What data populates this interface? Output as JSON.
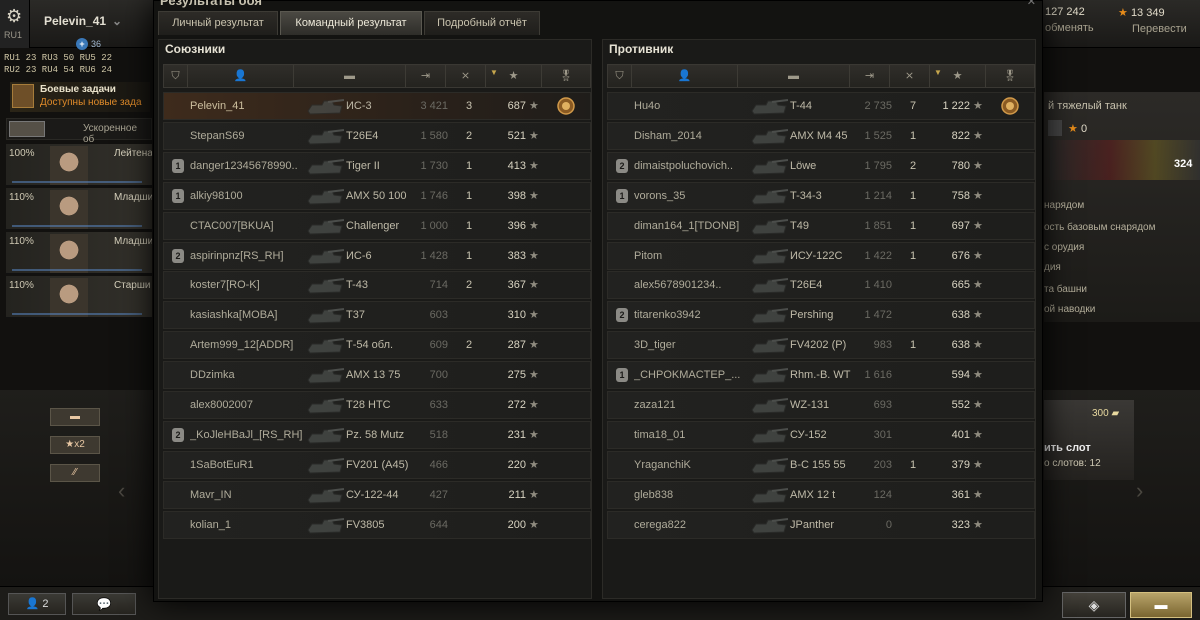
{
  "topbar": {
    "player_name": "Pelevin_41",
    "server": "RU1",
    "gold": "127 242",
    "gold_action": "обменять",
    "free_xp": "13 349",
    "free_xp_action": "Перевести",
    "online_count": "36",
    "server_lines": [
      "RU1 23 RU3 50 RU5 22",
      "RU2 23 RU4 54 RU6 24"
    ]
  },
  "left_panel": {
    "missions_title": "Боевые задачи",
    "missions_sub": "Доступны новые зада",
    "speedup": "Ускоренное об",
    "crew": [
      {
        "pct": "100%",
        "rank": "Лейтена"
      },
      {
        "pct": "110%",
        "rank": "Младши"
      },
      {
        "pct": "110%",
        "rank": "Младши"
      },
      {
        "pct": "110%",
        "rank": "Старши"
      }
    ],
    "x2_label": "★x2"
  },
  "right_panel": {
    "tank_type": "й тяжелый танк",
    "zero": "0",
    "value": "324",
    "mods": [
      "нарядом",
      "ость базовым снарядом",
      "с орудия",
      "дия",
      "та башни",
      "ой наводки"
    ],
    "slot_gold": "300",
    "slot_title": "ить слот",
    "slot_sub": "о слотов: 12"
  },
  "bottombar": {
    "players": "2"
  },
  "modal": {
    "title": "Результаты боя",
    "tabs": [
      "Личный результат",
      "Командный результат",
      "Подробный отчёт"
    ],
    "active_tab": 1,
    "allies_title": "Союзники",
    "enemies_title": "Противник"
  },
  "allies": [
    {
      "name": "Pelevin_41",
      "tank": "ИС-3",
      "damage": "3 421",
      "kills": "3",
      "xp": "687",
      "squad": "",
      "medal": true,
      "self": true
    },
    {
      "name": "StepanS69",
      "tank": "T26E4",
      "damage": "1 580",
      "kills": "2",
      "xp": "521",
      "squad": "",
      "medal": false
    },
    {
      "name": "danger12345678990..",
      "tank": "Tiger II",
      "damage": "1 730",
      "kills": "1",
      "xp": "413",
      "squad": "1",
      "medal": false
    },
    {
      "name": "alkiy98100",
      "tank": "AMX 50 100",
      "damage": "1 746",
      "kills": "1",
      "xp": "398",
      "squad": "1",
      "medal": false
    },
    {
      "name": "CTAC007[BKUA]",
      "tank": "Challenger",
      "damage": "1 000",
      "kills": "1",
      "xp": "396",
      "squad": "",
      "medal": false
    },
    {
      "name": "aspirinpnz[RS_RH]",
      "tank": "ИС-6",
      "damage": "1 428",
      "kills": "1",
      "xp": "383",
      "squad": "2",
      "medal": false
    },
    {
      "name": "koster7[RO-K]",
      "tank": "T-43",
      "damage": "714",
      "kills": "2",
      "xp": "367",
      "squad": "",
      "medal": false
    },
    {
      "name": "kasiashka[MOBA]",
      "tank": "T37",
      "damage": "603",
      "kills": "",
      "xp": "310",
      "squad": "",
      "medal": false
    },
    {
      "name": "Artem999_12[ADDR]",
      "tank": "Т-54 обл.",
      "damage": "609",
      "kills": "2",
      "xp": "287",
      "squad": "",
      "medal": false
    },
    {
      "name": "DDzimka",
      "tank": "AMX 13 75",
      "damage": "700",
      "kills": "",
      "xp": "275",
      "squad": "",
      "medal": false
    },
    {
      "name": "alex8002007",
      "tank": "T28 HTC",
      "damage": "633",
      "kills": "",
      "xp": "272",
      "squad": "",
      "medal": false
    },
    {
      "name": "_KoJleHBaJl_[RS_RH]",
      "tank": "Pz. 58 Mutz",
      "damage": "518",
      "kills": "",
      "xp": "231",
      "squad": "2",
      "medal": false
    },
    {
      "name": "1SaBotEuR1",
      "tank": "FV201 (A45)",
      "damage": "466",
      "kills": "",
      "xp": "220",
      "squad": "",
      "medal": false
    },
    {
      "name": "Mavr_IN",
      "tank": "СУ-122-44",
      "damage": "427",
      "kills": "",
      "xp": "211",
      "squad": "",
      "medal": false
    },
    {
      "name": "kolian_1",
      "tank": "FV3805",
      "damage": "644",
      "kills": "",
      "xp": "200",
      "squad": "",
      "medal": false
    }
  ],
  "enemies": [
    {
      "name": "Hu4o",
      "tank": "T-44",
      "damage": "2 735",
      "kills": "7",
      "xp": "1 222",
      "squad": "",
      "medal": true
    },
    {
      "name": "Disham_2014",
      "tank": "AMX M4 45",
      "damage": "1 525",
      "kills": "1",
      "xp": "822",
      "squad": "",
      "medal": false
    },
    {
      "name": "dimaistpoluchovich..",
      "tank": "Löwe",
      "damage": "1 795",
      "kills": "2",
      "xp": "780",
      "squad": "2",
      "medal": false
    },
    {
      "name": "vorons_35",
      "tank": "T-34-3",
      "damage": "1 214",
      "kills": "1",
      "xp": "758",
      "squad": "1",
      "medal": false
    },
    {
      "name": "diman164_1[TDONB]",
      "tank": "T49",
      "damage": "1 851",
      "kills": "1",
      "xp": "697",
      "squad": "",
      "medal": false
    },
    {
      "name": "Pitom",
      "tank": "ИСУ-122С",
      "damage": "1 422",
      "kills": "1",
      "xp": "676",
      "squad": "",
      "medal": false
    },
    {
      "name": "alex5678901234..",
      "tank": "T26E4",
      "damage": "1 410",
      "kills": "",
      "xp": "665",
      "squad": "",
      "medal": false
    },
    {
      "name": "titarenko3942",
      "tank": "Pershing",
      "damage": "1 472",
      "kills": "",
      "xp": "638",
      "squad": "2",
      "medal": false
    },
    {
      "name": "3D_tiger",
      "tank": "FV4202 (P)",
      "damage": "983",
      "kills": "1",
      "xp": "638",
      "squad": "",
      "medal": false
    },
    {
      "name": "_CHPOKMACTEP_...",
      "tank": "Rhm.-B. WT",
      "damage": "1 616",
      "kills": "",
      "xp": "594",
      "squad": "1",
      "medal": false
    },
    {
      "name": "zaza121",
      "tank": "WZ-131",
      "damage": "693",
      "kills": "",
      "xp": "552",
      "squad": "",
      "medal": false
    },
    {
      "name": "tima18_01",
      "tank": "СУ-152",
      "damage": "301",
      "kills": "",
      "xp": "401",
      "squad": "",
      "medal": false
    },
    {
      "name": "YraganchiK",
      "tank": "B-C 155 55",
      "damage": "203",
      "kills": "1",
      "xp": "379",
      "squad": "",
      "medal": false
    },
    {
      "name": "gleb838",
      "tank": "AMX 12 t",
      "damage": "124",
      "kills": "",
      "xp": "361",
      "squad": "",
      "medal": false
    },
    {
      "name": "cerega822",
      "tank": "JPanther",
      "damage": "0",
      "kills": "",
      "xp": "323",
      "squad": "",
      "medal": false
    }
  ]
}
